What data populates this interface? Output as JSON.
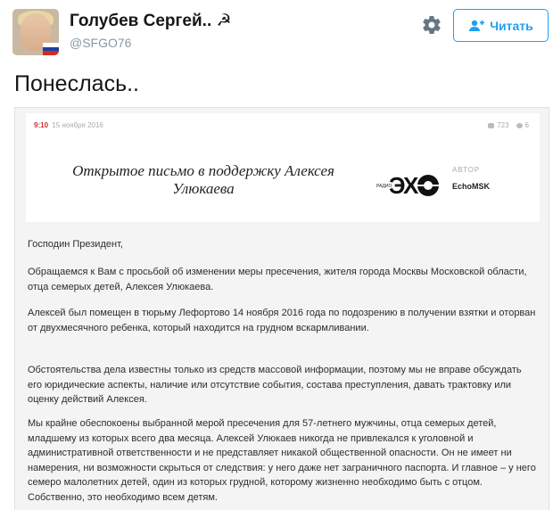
{
  "user": {
    "display_name": "Голубев Сергей.. ☭",
    "handle": "@SFGO76"
  },
  "follow_button": {
    "label": "Читать",
    "icon": "person-add-icon"
  },
  "settings_icon": "gear-icon",
  "tweet": {
    "text": "Понеслась.."
  },
  "article": {
    "time": "9:10",
    "date": "15 ноября 2016",
    "views": "723",
    "comments": "6",
    "title": "Открытое письмо в поддержку Алексея Улюкаева",
    "logo_text": "ЭХО",
    "author_label": "АВТОР",
    "author_name": "EchoMSK"
  },
  "letter": {
    "p1": "Господин Президент,",
    "p2": "Обращаемся к Вам с просьбой об изменении меры пресечения, жителя города Москвы Московской области, отца семерых детей, Алексея Улюкаева.",
    "p3": "Алексей был помещен в тюрьму Лефортово 14 ноября 2016 года по подозрению в получении взятки и оторван от двухмесячного ребенка, который находится на грудном вскармливании.",
    "p4": "Обстоятельства дела известны только из средств массовой информации, поэтому мы не вправе обсуждать его юридические аспекты, наличие или отсутствие события, состава преступления, давать трактовку или оценку действий Алексея.",
    "p5": "Мы крайне обеспокоены выбранной мерой пресечения для 57-летнего мужчины, отца семерых детей, младшему из которых всего два месяца. Алексей Улюкаев никогда не привлекался к уголовной и административной ответственности и не представляет никакой общественной опасности. Он не имеет ни намерения, ни возможности скрыться от следствия: у него даже нет заграничного паспорта. И главное – у него семеро малолетних детей, один из которых грудной, которому жизненно необходимо быть с отцом. Собственно, это необходимо всем детям."
  },
  "colors": {
    "accent": "#1da1f2",
    "time_red": "#cc3333"
  }
}
